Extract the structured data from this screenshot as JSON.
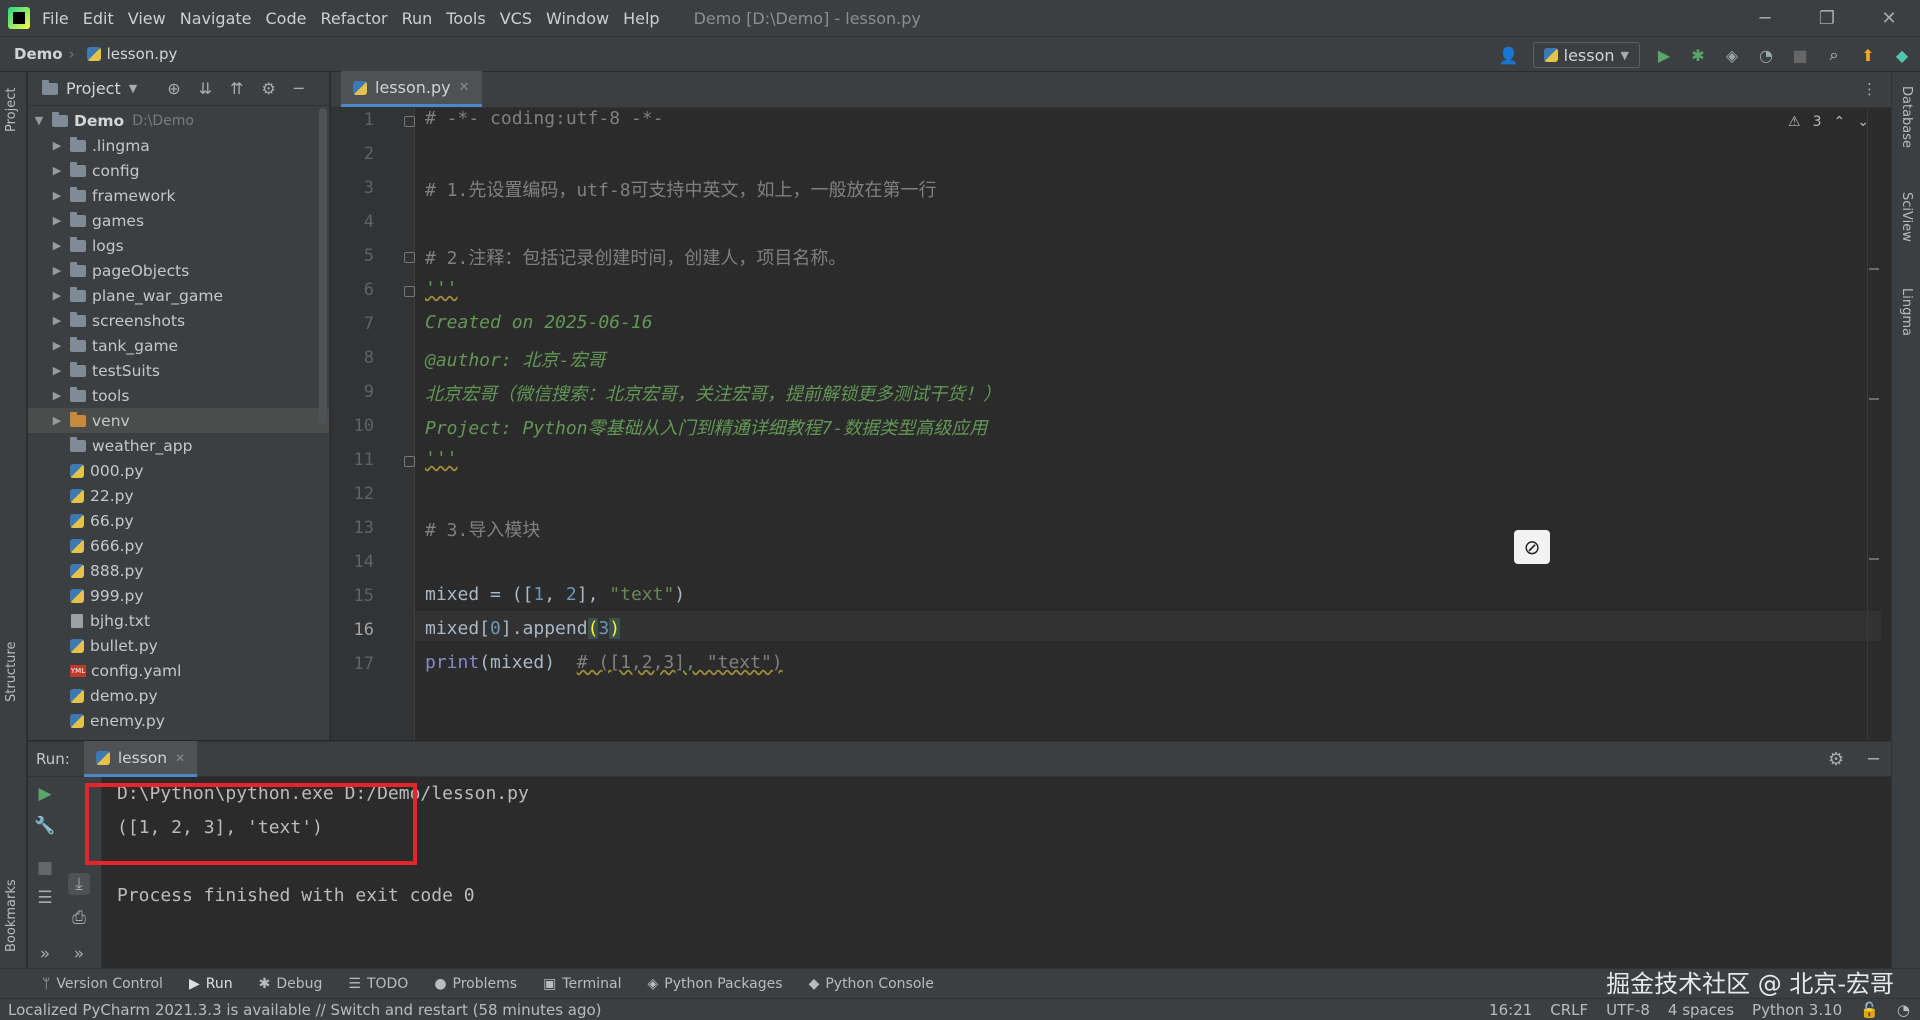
{
  "menubar": {
    "items": [
      "File",
      "Edit",
      "View",
      "Navigate",
      "Code",
      "Refactor",
      "Run",
      "Tools",
      "VCS",
      "Window",
      "Help"
    ],
    "window_title": "Demo [D:\\Demo] - lesson.py"
  },
  "navbar": {
    "project": "Demo",
    "file": "lesson.py",
    "run_config": "lesson"
  },
  "left_strip": {
    "project_label": "Project",
    "structure_label": "Structure",
    "bookmarks_label": "Bookmarks"
  },
  "right_strip": {
    "database_label": "Database",
    "sciview_label": "SciView",
    "lingma_label": "Lingma"
  },
  "project_panel": {
    "title": "Project",
    "root": {
      "name": "Demo",
      "path": "D:\\Demo"
    },
    "folders": [
      ".lingma",
      "config",
      "framework",
      "games",
      "logs",
      "pageObjects",
      "plane_war_game",
      "screenshots",
      "tank_game",
      "testSuits",
      "tools",
      "venv",
      "weather_app"
    ],
    "files": [
      "000.py",
      "22.py",
      "66.py",
      "666.py",
      "888.py",
      "999.py",
      "bjhg.txt",
      "bullet.py",
      "config.yaml",
      "demo.py",
      "enemy.py"
    ]
  },
  "editor": {
    "tab": "lesson.py",
    "warnings": "3",
    "current_line": "16",
    "lines": [
      "# -*- coding:utf-8 -*-",
      "",
      "# 1.先设置编码，utf-8可支持中英文，如上，一般放在第一行",
      "",
      "# 2.注释：包括记录创建时间，创建人，项目名称。",
      "'''",
      "Created on 2025-06-16",
      "@author: 北京-宏哥",
      "北京宏哥（微信搜索：北京宏哥，关注宏哥，提前解锁更多测试干货！）",
      "Project: Python零基础从入门到精通详细教程7-数据类型高级应用",
      "'''",
      "",
      "# 3.导入模块",
      "",
      "mixed = ([1, 2], \"text\")",
      "mixed[0].append(3)",
      "print(mixed)  # ([1,2,3], \"text\")"
    ]
  },
  "run_panel": {
    "label": "Run:",
    "tab": "lesson",
    "console": [
      "D:\\Python\\python.exe D:/Demo/lesson.py",
      "([1, 2, 3], 'text')",
      "",
      "Process finished with exit code 0"
    ]
  },
  "bottom_tools": [
    "Version Control",
    "Run",
    "Debug",
    "TODO",
    "Problems",
    "Terminal",
    "Python Packages",
    "Python Console"
  ],
  "watermark": "掘金技术社区 @ 北京-宏哥",
  "statusbar": {
    "message": "Localized PyCharm 2021.3.3 is available // Switch and restart (58 minutes ago)",
    "position": "16:21",
    "line_sep": "CRLF",
    "encoding": "UTF-8",
    "indent": "4 spaces",
    "interpreter": "Python 3.10"
  },
  "colors": {
    "accent": "#4a88c7",
    "highlight_box": "#e8232c"
  }
}
